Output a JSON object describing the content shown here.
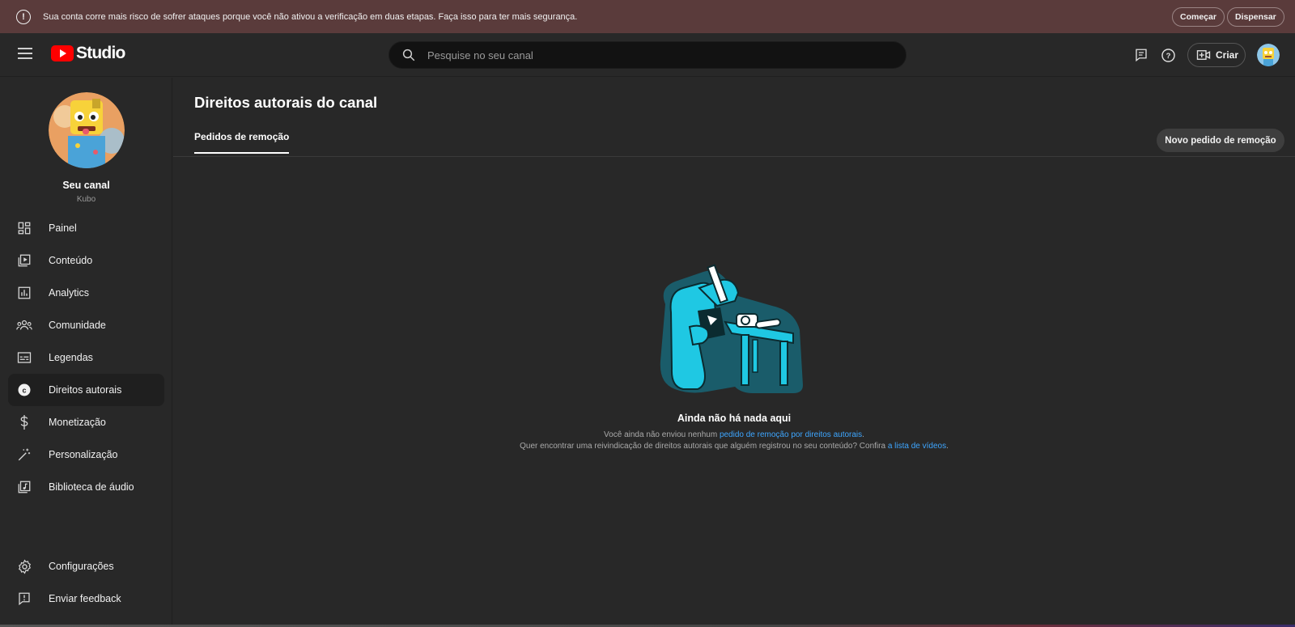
{
  "banner": {
    "message": "Sua conta corre mais risco de sofrer ataques porque você não ativou a verificação em duas etapas. Faça isso para ter mais segurança.",
    "start_label": "Começar",
    "dismiss_label": "Dispensar"
  },
  "header": {
    "logo_text": "Studio",
    "search_placeholder": "Pesquise no seu canal",
    "create_label": "Criar"
  },
  "sidebar": {
    "channel_title": "Seu canal",
    "channel_handle": "Kubo",
    "items": [
      {
        "label": "Painel",
        "icon": "dashboard-icon"
      },
      {
        "label": "Conteúdo",
        "icon": "content-icon"
      },
      {
        "label": "Analytics",
        "icon": "analytics-icon"
      },
      {
        "label": "Comunidade",
        "icon": "community-icon"
      },
      {
        "label": "Legendas",
        "icon": "subtitles-icon"
      },
      {
        "label": "Direitos autorais",
        "icon": "copyright-icon",
        "active": true
      },
      {
        "label": "Monetização",
        "icon": "dollar-icon"
      },
      {
        "label": "Personalização",
        "icon": "magic-wand-icon"
      },
      {
        "label": "Biblioteca de áudio",
        "icon": "audio-library-icon"
      }
    ],
    "footer_items": [
      {
        "label": "Configurações",
        "icon": "gear-icon"
      },
      {
        "label": "Enviar feedback",
        "icon": "feedback-icon"
      }
    ]
  },
  "main": {
    "title": "Direitos autorais do canal",
    "tab_label": "Pedidos de remoção",
    "new_request_label": "Novo pedido de remoção",
    "empty": {
      "title": "Ainda não há nada aqui",
      "line1_prefix": "Você ainda não enviou nenhum ",
      "line1_link": "pedido de remoção por direitos autorais",
      "line1_suffix": ".",
      "line2_prefix": "Quer encontrar uma reivindicação de direitos autorais que alguém registrou no seu conteúdo? Confira ",
      "line2_link": "a lista de vídeos",
      "line2_suffix": "."
    }
  },
  "colors": {
    "accent_red": "#ff0000",
    "link_blue": "#3ea6ff",
    "banner_bg": "#5a3b3b",
    "surface": "#282828"
  }
}
